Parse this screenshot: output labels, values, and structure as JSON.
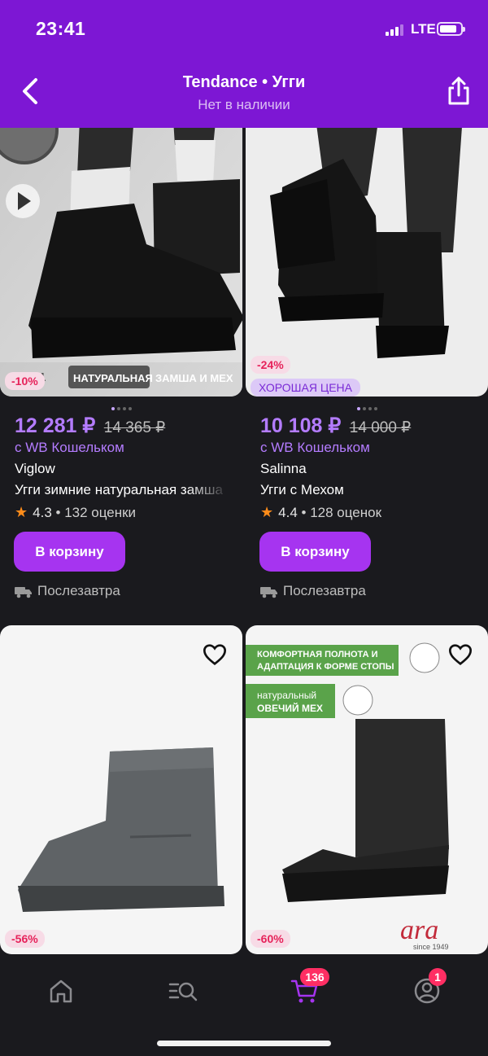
{
  "status_bar": {
    "time": "23:41",
    "network": "LTE"
  },
  "header": {
    "title": "Tendance • Угги",
    "subtitle": "Нет в наличии",
    "back_icon": "chevron-left-icon",
    "share_icon": "share-icon"
  },
  "products": [
    {
      "discount": "-10%",
      "image_text": [
        "36-41",
        "НАТУРАЛЬНАЯ",
        "ЗАМША И МЕХ"
      ],
      "price": "12 281 ₽",
      "old_price": "14 365 ₽",
      "wallet": "с WB Кошельком",
      "brand": "Viglow",
      "name": "Угги зимние натуральная замша",
      "rating": "4.3",
      "reviews": "• 132 оценки",
      "cart_label": "В корзину",
      "delivery": "Послезавтра",
      "colors": {
        "image_bg": "#d4d4d4"
      }
    },
    {
      "discount": "-24%",
      "badge": "ХОРОШАЯ ЦЕНА",
      "price": "10 108 ₽",
      "old_price": "14 000 ₽",
      "wallet": "с WB Кошельком",
      "brand": "Salinna",
      "name": "Угги с Мехом",
      "rating": "4.4",
      "reviews": "• 128 оценок",
      "cart_label": "В корзину",
      "delivery": "Послезавтра",
      "colors": {
        "image_bg": "#eeeeee"
      }
    },
    {
      "discount": "-56%",
      "colors": {
        "image_bg": "#f5f5f5"
      }
    },
    {
      "discount": "-60%",
      "image_text": [
        "КОМФОРТНАЯ ПОЛНОТА И",
        "АДАПТАЦИЯ К ФОРМЕ СТОПЫ",
        "натуральный",
        "ОВЕЧИЙ МЕХ",
        "ara",
        "since 1949"
      ],
      "colors": {
        "image_bg": "#f4f4f4"
      }
    }
  ],
  "bottom_nav": {
    "items": [
      "home-icon",
      "catalog-search-icon",
      "cart-icon",
      "profile-icon"
    ],
    "cart_badge": "136",
    "profile_badge": "1"
  },
  "colors": {
    "header": "#7d17d4",
    "accent": "#a634f0",
    "price": "#b47cff",
    "background": "#1a1a1e",
    "badge": "#ff2e63"
  }
}
